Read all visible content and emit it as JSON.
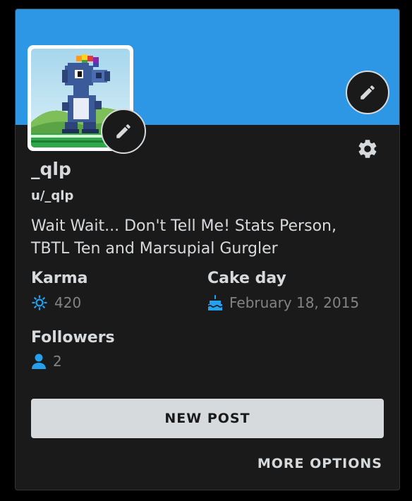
{
  "colors": {
    "banner": "#2d97e5",
    "card_bg": "#1a1a1b",
    "text": "#d7dadc",
    "muted": "#818384",
    "accent": "#24a0ed"
  },
  "profile": {
    "display_name": "_qlp",
    "username": "u/_qlp",
    "bio": "Wait Wait... Don't Tell Me! Stats Person, TBTL Ten and Marsupial Gurgler",
    "avatar_icon": "pixel-birdo-avatar",
    "banner_edit_icon": "pencil-icon",
    "avatar_edit_icon": "pencil-icon",
    "settings_icon": "gear-icon"
  },
  "stats": {
    "karma": {
      "label": "Karma",
      "value": "420",
      "icon": "karma-icon"
    },
    "cake_day": {
      "label": "Cake day",
      "value": "February 18, 2015",
      "icon": "cake-icon"
    },
    "followers": {
      "label": "Followers",
      "value": "2",
      "icon": "user-icon"
    }
  },
  "actions": {
    "new_post": "NEW POST",
    "more_options": "MORE OPTIONS"
  }
}
